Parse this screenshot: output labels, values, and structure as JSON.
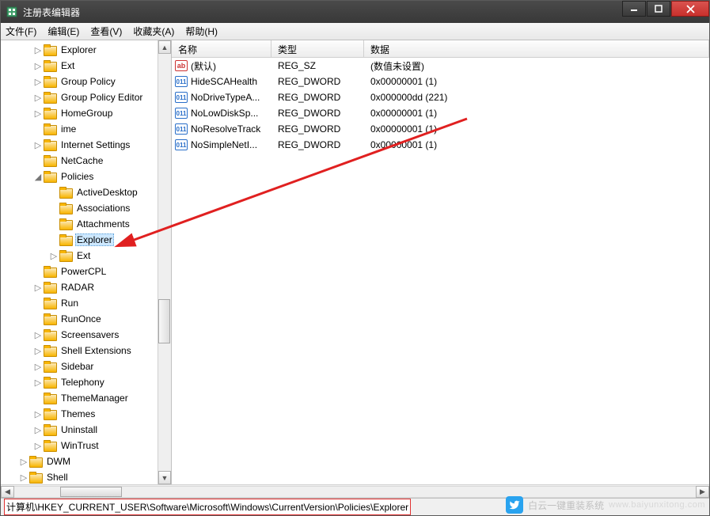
{
  "window": {
    "title": "注册表编辑器"
  },
  "menu": {
    "file": "文件(F)",
    "edit": "编辑(E)",
    "view": "查看(V)",
    "favorites": "收藏夹(A)",
    "help": "帮助(H)"
  },
  "tree": {
    "items": [
      {
        "label": "Explorer",
        "indent": 1,
        "exp": "▷"
      },
      {
        "label": "Ext",
        "indent": 1,
        "exp": "▷"
      },
      {
        "label": "Group Policy",
        "indent": 1,
        "exp": "▷"
      },
      {
        "label": "Group Policy Editor",
        "indent": 1,
        "exp": "▷"
      },
      {
        "label": "HomeGroup",
        "indent": 1,
        "exp": "▷"
      },
      {
        "label": "ime",
        "indent": 1,
        "exp": ""
      },
      {
        "label": "Internet Settings",
        "indent": 1,
        "exp": "▷"
      },
      {
        "label": "NetCache",
        "indent": 1,
        "exp": ""
      },
      {
        "label": "Policies",
        "indent": 1,
        "exp": "◢"
      },
      {
        "label": "ActiveDesktop",
        "indent": 2,
        "exp": ""
      },
      {
        "label": "Associations",
        "indent": 2,
        "exp": ""
      },
      {
        "label": "Attachments",
        "indent": 2,
        "exp": ""
      },
      {
        "label": "Explorer",
        "indent": 2,
        "exp": "",
        "selected": true
      },
      {
        "label": "Ext",
        "indent": 2,
        "exp": "▷"
      },
      {
        "label": "PowerCPL",
        "indent": 1,
        "exp": ""
      },
      {
        "label": "RADAR",
        "indent": 1,
        "exp": "▷"
      },
      {
        "label": "Run",
        "indent": 1,
        "exp": ""
      },
      {
        "label": "RunOnce",
        "indent": 1,
        "exp": ""
      },
      {
        "label": "Screensavers",
        "indent": 1,
        "exp": "▷"
      },
      {
        "label": "Shell Extensions",
        "indent": 1,
        "exp": "▷"
      },
      {
        "label": "Sidebar",
        "indent": 1,
        "exp": "▷"
      },
      {
        "label": "Telephony",
        "indent": 1,
        "exp": "▷"
      },
      {
        "label": "ThemeManager",
        "indent": 1,
        "exp": ""
      },
      {
        "label": "Themes",
        "indent": 1,
        "exp": "▷"
      },
      {
        "label": "Uninstall",
        "indent": 1,
        "exp": "▷"
      },
      {
        "label": "WinTrust",
        "indent": 1,
        "exp": "▷"
      },
      {
        "label": "DWM",
        "indent": 0,
        "exp": "▷"
      },
      {
        "label": "Shell",
        "indent": 0,
        "exp": "▷"
      }
    ]
  },
  "columns": {
    "name": "名称",
    "type": "类型",
    "data": "数据"
  },
  "rows": [
    {
      "icon": "sz",
      "name": "(默认)",
      "type": "REG_SZ",
      "data": "(数值未设置)"
    },
    {
      "icon": "dw",
      "name": "HideSCAHealth",
      "type": "REG_DWORD",
      "data": "0x00000001 (1)"
    },
    {
      "icon": "dw",
      "name": "NoDriveTypeA...",
      "type": "REG_DWORD",
      "data": "0x000000dd (221)"
    },
    {
      "icon": "dw",
      "name": "NoLowDiskSp...",
      "type": "REG_DWORD",
      "data": "0x00000001 (1)"
    },
    {
      "icon": "dw",
      "name": "NoResolveTrack",
      "type": "REG_DWORD",
      "data": "0x00000001 (1)"
    },
    {
      "icon": "dw",
      "name": "NoSimpleNetI...",
      "type": "REG_DWORD",
      "data": "0x00000001 (1)"
    }
  ],
  "status": {
    "path": "计算机\\HKEY_CURRENT_USER\\Software\\Microsoft\\Windows\\CurrentVersion\\Policies\\Explorer"
  },
  "watermark": {
    "text": "白云一键重装系统",
    "url": "www.baiyunxitong.com"
  }
}
